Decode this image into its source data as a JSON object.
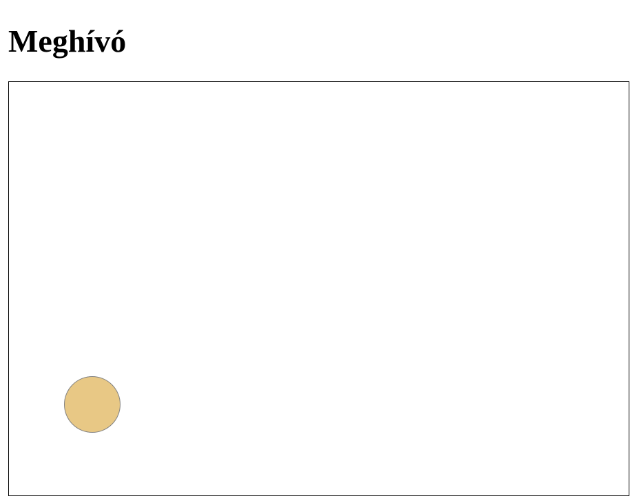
{
  "page": {
    "title": "Meghívó"
  },
  "canvas": {
    "ball_color": "#E8C885",
    "ball_border_color": "#808080"
  }
}
